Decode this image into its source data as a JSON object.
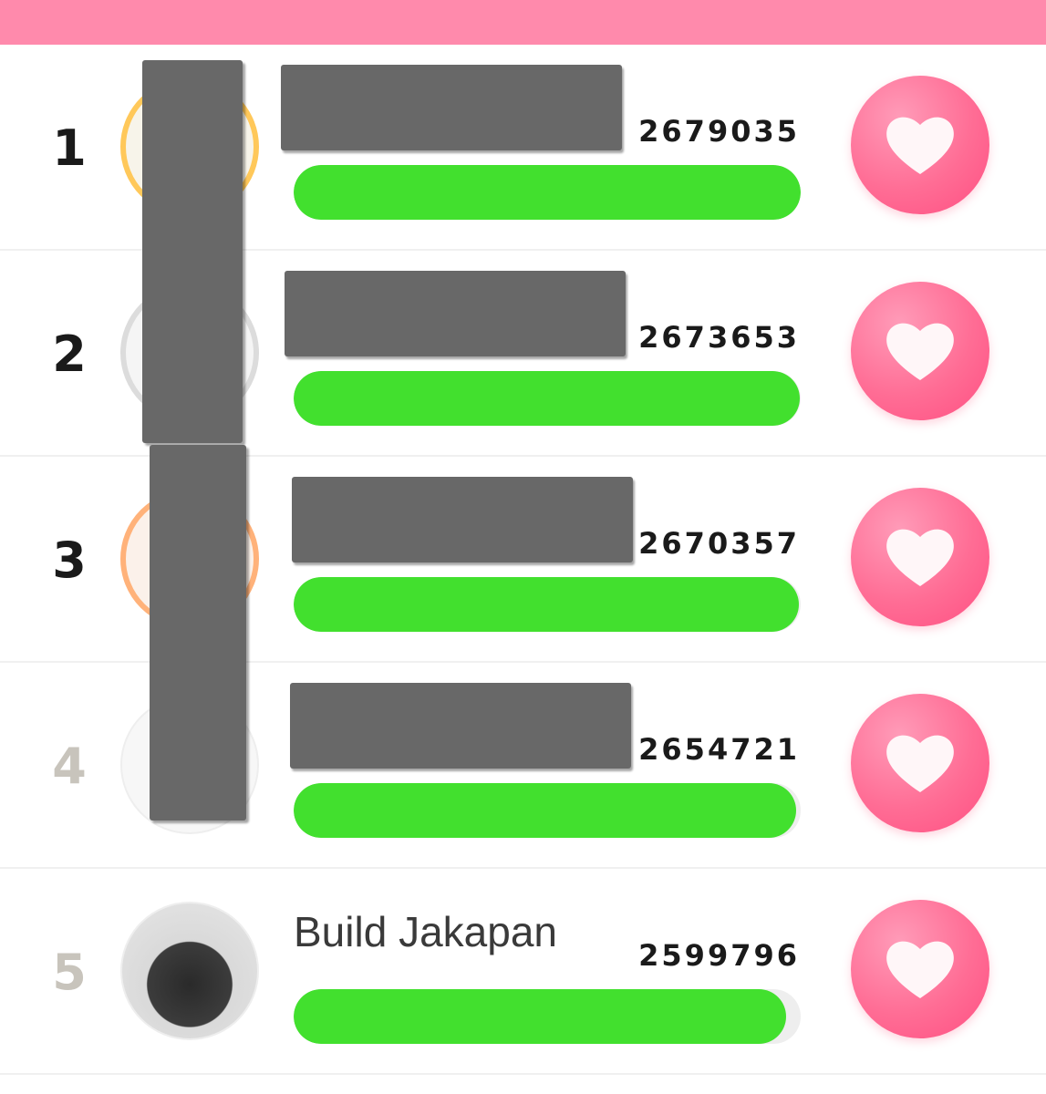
{
  "header": {
    "color": "#ff8aac"
  },
  "accent_colors": {
    "bar_fill": "#42e02e",
    "heart_button": "#ff6d95"
  },
  "rankings": [
    {
      "rank": "1",
      "name": "",
      "name_redacted": true,
      "votes": "2679035",
      "progress": 1.0,
      "ring": "gold"
    },
    {
      "rank": "2",
      "name": "",
      "name_redacted": true,
      "votes": "2673653",
      "progress": 0.998,
      "ring": "silver"
    },
    {
      "rank": "3",
      "name": "",
      "name_redacted": true,
      "votes": "2670357",
      "progress": 0.997,
      "ring": "bronze"
    },
    {
      "rank": "4",
      "name": "",
      "name_redacted": true,
      "votes": "2654721",
      "progress": 0.991,
      "ring": "none"
    },
    {
      "rank": "5",
      "name": "Build Jakapan",
      "name_redacted": false,
      "votes": "2599796",
      "progress": 0.971,
      "ring": "none"
    }
  ],
  "vote_button_icon": "heart-icon"
}
